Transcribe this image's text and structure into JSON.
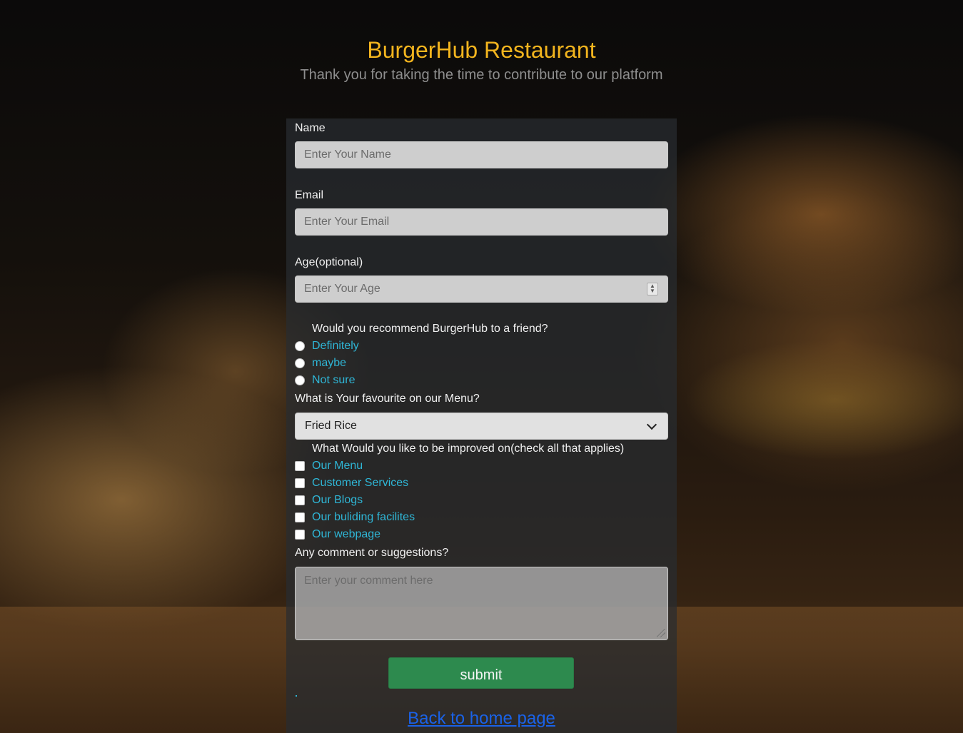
{
  "header": {
    "title": "BurgerHub Restaurant",
    "subtitle": "Thank you for taking the time to contribute to our platform"
  },
  "form": {
    "name": {
      "label": "Name",
      "placeholder": "Enter Your Name",
      "value": ""
    },
    "email": {
      "label": "Email",
      "placeholder": "Enter Your Email",
      "value": ""
    },
    "age": {
      "label": "Age(optional)",
      "placeholder": "Enter Your Age",
      "value": ""
    },
    "recommend": {
      "question": "Would you recommend BurgerHub to a friend?",
      "options": [
        "Definitely",
        "maybe",
        "Not sure"
      ]
    },
    "favourite": {
      "label": "What is Your favourite on our Menu?",
      "selected": "Fried Rice"
    },
    "improve": {
      "question": "What Would you like to be improved on(check all that applies)",
      "options": [
        "Our Menu",
        "Customer Services",
        "Our Blogs",
        "Our buliding facilites",
        "Our webpage"
      ]
    },
    "comment": {
      "label": "Any comment or suggestions?",
      "placeholder": "Enter your comment here"
    },
    "submit_label": "submit",
    "home_link": "Back to home page"
  },
  "colors": {
    "title": "#f2b41e",
    "option_text": "#2fb6d6",
    "submit": "#2d8a4e",
    "link": "#1a62e8"
  }
}
